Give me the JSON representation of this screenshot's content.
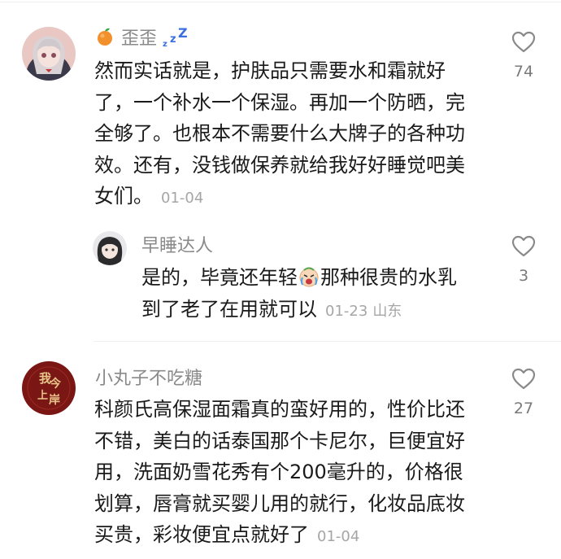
{
  "comments": [
    {
      "user": "歪歪",
      "text_lines": [
        "然而实话就是，护肤品只需要水和霜就好",
        "了，一个补水一个保湿。再加一个防晒，完",
        "全够了。也根本不需要什么大牌子的各种功",
        "效。还有，没钱做保养就给我好好睡觉吧美",
        "女们。"
      ],
      "date": "01-04",
      "likes": "74",
      "badges": [
        "orange-icon",
        "zzz-icon"
      ],
      "reply": {
        "user": "早睡达人",
        "text_line1_a": "是的，毕竟还年轻",
        "text_line1_b": "那种很贵的水乳",
        "text_line2": "到了老了在用就可以",
        "date": "01-23",
        "location": "山东",
        "likes": "3"
      }
    },
    {
      "user": "小丸子不吃糖",
      "text_lines": [
        "科颜氏高保湿面霜真的蛮好用的，性价比还",
        "不错，美白的话泰国那个卡尼尔，巨便宜好",
        "用，洗面奶雪花秀有个200毫升的，价格很",
        "划算，唇膏就买婴儿用的就行，化妆品底妆",
        "买贵，彩妆便宜点就好了"
      ],
      "date": "01-04",
      "likes": "27",
      "avatar_text": "我今上岸"
    }
  ],
  "colors": {
    "text": "#1a1a1a",
    "name": "#8a8a8a",
    "meta": "#a6a6a6",
    "zzz": "#3b6fe0"
  }
}
